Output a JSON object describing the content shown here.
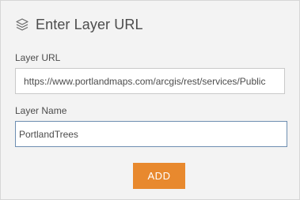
{
  "header": {
    "title": "Enter Layer URL",
    "icon": "layers-icon"
  },
  "form": {
    "url_label": "Layer URL",
    "url_value": "https://www.portlandmaps.com/arcgis/rest/services/Public",
    "name_label": "Layer Name",
    "name_value": "PortlandTrees",
    "add_label": "ADD"
  },
  "colors": {
    "accent": "#e8892e",
    "panel_bg": "#f3f3f3",
    "text": "#4c4c4c",
    "focus_border": "#6e8eb1"
  }
}
